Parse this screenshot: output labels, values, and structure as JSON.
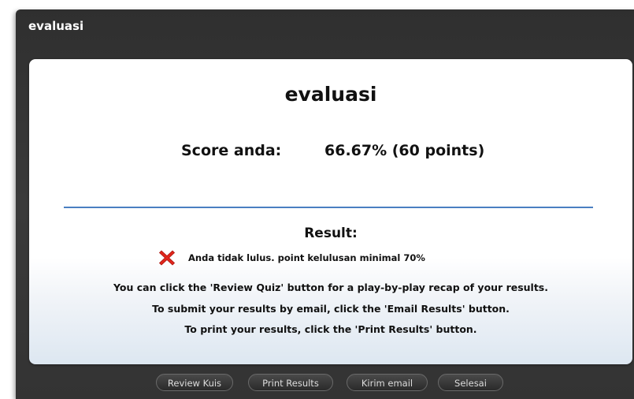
{
  "window": {
    "title": "evaluasi"
  },
  "quiz": {
    "title": "evaluasi",
    "score_label": "Score anda:",
    "score_value": "66.67% (60 points)"
  },
  "result": {
    "heading": "Result:",
    "status_icon": "red-x-icon",
    "message": "Anda tidak lulus. point kelulusan minimal 70%",
    "info": [
      "You can click the 'Review Quiz' button for a play-by-play recap of your results.",
      "To submit your results by email, click the 'Email Results' button.",
      "To print your results, click the 'Print Results' button."
    ]
  },
  "buttons": {
    "review": "Review Kuis",
    "print": "Print Results",
    "email": "Kirim email",
    "finish": "Selesai"
  },
  "colors": {
    "divider": "#4a7fc1",
    "fail_icon": "#e0261c",
    "window_bg": "#333333"
  }
}
